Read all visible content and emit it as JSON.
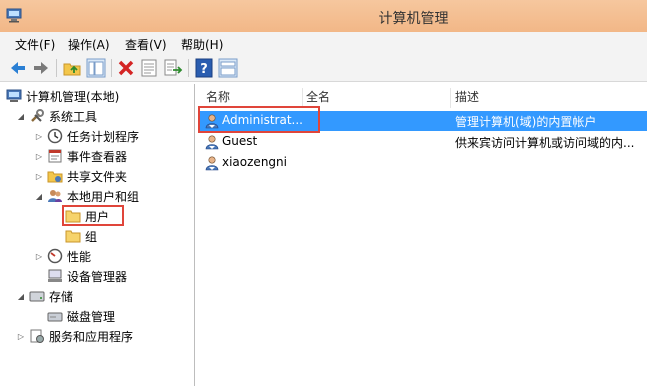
{
  "window": {
    "title": "计算机管理"
  },
  "menu": [
    "文件(F)",
    "操作(A)",
    "查看(V)",
    "帮助(H)"
  ],
  "toolbar": [
    "back-arrow-icon",
    "forward-arrow-icon",
    "up-folder-icon",
    "show-pane-icon",
    "delete-icon",
    "properties-icon",
    "export-icon",
    "help-icon",
    "view-icon"
  ],
  "tree": {
    "root": "计算机管理(本地)",
    "system_tools": "系统工具",
    "task_scheduler": "任务计划程序",
    "event_viewer": "事件查看器",
    "shared_folders": "共享文件夹",
    "local_users_groups": "本地用户和组",
    "users": "用户",
    "groups": "组",
    "performance": "性能",
    "device_manager": "设备管理器",
    "storage": "存储",
    "disk_management": "磁盘管理",
    "services_apps": "服务和应用程序"
  },
  "columns": {
    "name": "名称",
    "fullname": "全名",
    "description": "描述"
  },
  "users": [
    {
      "name": "Administrat...",
      "fullname": "",
      "description": "管理计算机(域)的内置帐户"
    },
    {
      "name": "Guest",
      "fullname": "",
      "description": "供来宾访问计算机或访问域的内..."
    },
    {
      "name": "xiaozengni",
      "fullname": "",
      "description": ""
    }
  ],
  "colors": {
    "selection": "#3399ff",
    "highlight_box": "#e0453a",
    "titlebar": "#f2b787"
  }
}
